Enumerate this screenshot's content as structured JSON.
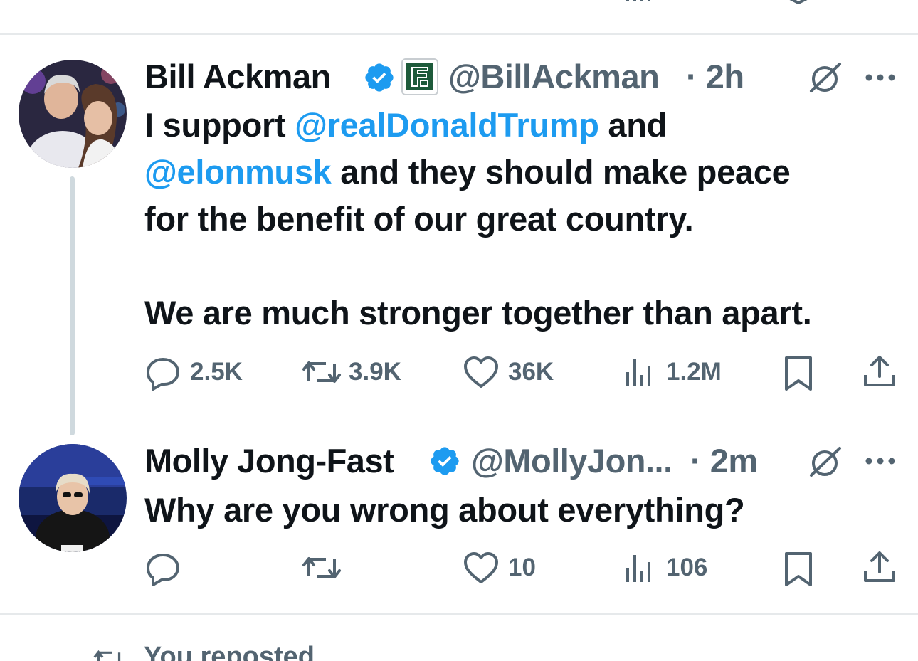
{
  "tweet1": {
    "name": "Bill Ackman",
    "handle": "@BillAckman",
    "time": "· 2h",
    "line1_a": "I support ",
    "line1_mention": "@realDonaldTrump",
    "line1_b": " and",
    "line2_mention": "@elonmusk",
    "line2_b": " and they should make peace",
    "line3": "for the benefit of our great country.",
    "line4": "We are much stronger together than apart.",
    "replies": "2.5K",
    "reposts": "3.9K",
    "likes": "36K",
    "views": "1.2M"
  },
  "tweet2": {
    "name": "Molly Jong-Fast",
    "handle": "@MollyJon...",
    "time": "· 2m",
    "text": "Why are you wrong about everything?",
    "likes": "10",
    "views": "106"
  },
  "footer": {
    "reposted_label": "You reposted"
  },
  "colors": {
    "accent": "#1d9bf0",
    "muted": "#536471",
    "divider": "#e6e9eb",
    "thread_line": "#cfd9de"
  },
  "icons": [
    "verified-badge-icon",
    "affiliate-logo-icon",
    "grok-icon",
    "more-icon",
    "reply-icon",
    "repost-icon",
    "like-icon",
    "views-icon",
    "bookmark-icon",
    "share-icon"
  ]
}
